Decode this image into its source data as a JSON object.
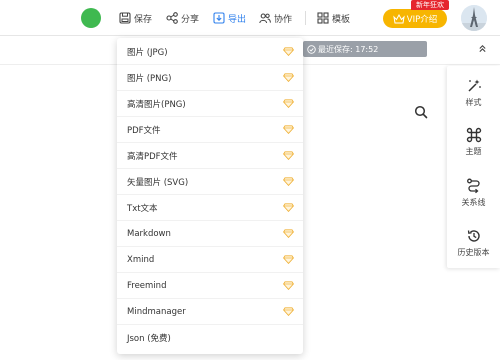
{
  "toolbar": {
    "save_label": "保存",
    "share_label": "分享",
    "export_label": "导出",
    "collaborate_label": "协作",
    "template_label": "模板",
    "vip_label": "VIP介绍",
    "promo_badge": "新年狂欢"
  },
  "autosave": {
    "text": "最近保存: 17:52"
  },
  "export_menu": {
    "items": [
      {
        "label": "图片 (JPG)",
        "vip": true
      },
      {
        "label": "图片 (PNG)",
        "vip": true
      },
      {
        "label": "高清图片(PNG)",
        "vip": true
      },
      {
        "label": "PDF文件",
        "vip": true
      },
      {
        "label": "高清PDF文件",
        "vip": true
      },
      {
        "label": "矢量图片 (SVG)",
        "vip": true
      },
      {
        "label": "Txt文本",
        "vip": true
      },
      {
        "label": "Markdown",
        "vip": true
      },
      {
        "label": "Xmind",
        "vip": true
      },
      {
        "label": "Freemind",
        "vip": true
      },
      {
        "label": "Mindmanager",
        "vip": true
      },
      {
        "label": "Json (免费)",
        "vip": false
      }
    ]
  },
  "side_panel": {
    "items": [
      {
        "label": "样式",
        "icon": "magic-wand-icon"
      },
      {
        "label": "主题",
        "icon": "command-icon"
      },
      {
        "label": "关系线",
        "icon": "relation-line-icon"
      },
      {
        "label": "历史版本",
        "icon": "history-icon"
      }
    ]
  },
  "colors": {
    "accent": "#2f80ed",
    "vip_gold": "#f7b500",
    "promo_red": "#e5262d",
    "status_green": "#3fb950",
    "autosave_bg": "#9aa0a8"
  }
}
